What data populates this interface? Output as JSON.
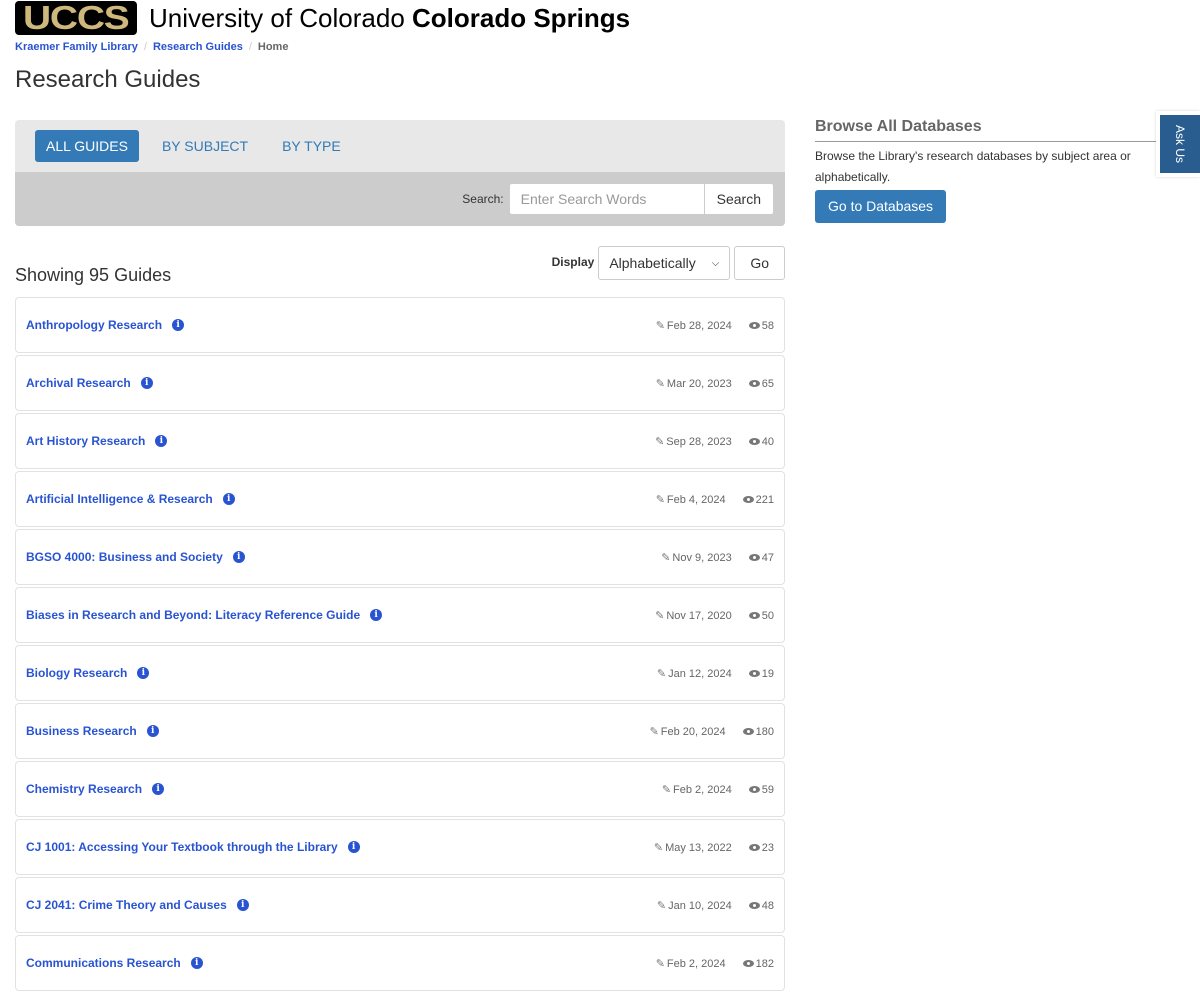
{
  "header": {
    "logo_text": "UCCS",
    "university_prefix": "University of Colorado",
    "university_bold": "Colorado Springs"
  },
  "breadcrumb": [
    {
      "label": "Kraemer Family Library"
    },
    {
      "label": "Research Guides"
    },
    {
      "label": "Home"
    }
  ],
  "page_title": "Research Guides",
  "tabs": [
    {
      "label": "ALL GUIDES",
      "active": true
    },
    {
      "label": "BY SUBJECT",
      "active": false
    },
    {
      "label": "BY TYPE",
      "active": false
    }
  ],
  "search": {
    "label": "Search:",
    "placeholder": "Enter Search Words",
    "button_label": "Search"
  },
  "listing": {
    "showing_text": "Showing 95 Guides",
    "display_label": "Display",
    "display_selected": "Alphabetically",
    "go_label": "Go"
  },
  "guides": [
    {
      "title": "Anthropology Research",
      "date": "Feb 28, 2024",
      "views": "58"
    },
    {
      "title": "Archival Research",
      "date": "Mar 20, 2023",
      "views": "65"
    },
    {
      "title": "Art History Research",
      "date": "Sep 28, 2023",
      "views": "40"
    },
    {
      "title": "Artificial Intelligence & Research",
      "date": "Feb 4, 2024",
      "views": "221"
    },
    {
      "title": "BGSO 4000: Business and Society",
      "date": "Nov 9, 2023",
      "views": "47"
    },
    {
      "title": "Biases in Research and Beyond: Literacy Reference Guide",
      "date": "Nov 17, 2020",
      "views": "50"
    },
    {
      "title": "Biology Research",
      "date": "Jan 12, 2024",
      "views": "19"
    },
    {
      "title": "Business Research",
      "date": "Feb 20, 2024",
      "views": "180"
    },
    {
      "title": "Chemistry Research",
      "date": "Feb 2, 2024",
      "views": "59"
    },
    {
      "title": "CJ 1001: Accessing Your Textbook through the Library",
      "date": "May 13, 2022",
      "views": "23"
    },
    {
      "title": "CJ 2041: Crime Theory and Causes",
      "date": "Jan 10, 2024",
      "views": "48"
    },
    {
      "title": "Communications Research",
      "date": "Feb 2, 2024",
      "views": "182"
    }
  ],
  "sidebar": {
    "title": "Browse All Databases",
    "text": "Browse the Library's research databases by subject area or alphabetically.",
    "button_label": "Go to Databases"
  },
  "ask_us": {
    "label": "Ask Us"
  },
  "icons": {
    "info": "i",
    "edit": "✎"
  },
  "colors": {
    "accent": "#337ab7",
    "link": "#2954d1",
    "logo_gold": "#cfb87c",
    "ask_us": "#2a5d8f"
  }
}
